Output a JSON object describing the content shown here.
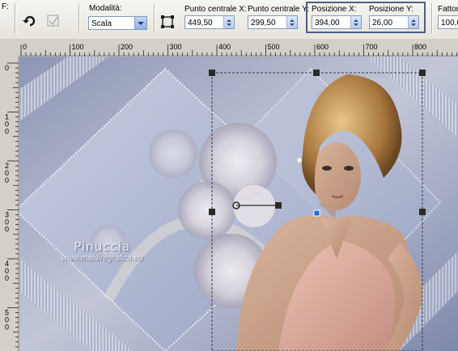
{
  "toolbar": {
    "modalita_label": "Modalità:",
    "modalita_value": "Scala",
    "centro_x_label": "Punto centrale X:",
    "centro_x_value": "449,50",
    "centro_y_label": "Punto centrale Y:",
    "centro_y_value": "299,50",
    "pos_x_label": "Posizione X:",
    "pos_x_value": "394,00",
    "pos_y_label": "Posizione Y:",
    "pos_y_value": "26,00",
    "fattore_label": "Fattor",
    "fattore_value": "100,0",
    "left_partial_label": "F:"
  },
  "ruler_top": {
    "labels": [
      "0",
      "100",
      "200",
      "300",
      "400",
      "500",
      "600",
      "700",
      "800"
    ]
  },
  "ruler_left": {
    "labels": [
      "0",
      "1\n0\n0",
      "2\n0\n0",
      "3\n0\n0",
      "4\n0\n0",
      "5\n0\n0"
    ]
  },
  "watermark": {
    "line1": "Pinuccia",
    "line2": "www.maidiregrafica.eu"
  },
  "icons": {
    "reset": "rotate-arrow-icon",
    "apply": "apply-transform-icon",
    "pick": "select-frame-icon"
  }
}
